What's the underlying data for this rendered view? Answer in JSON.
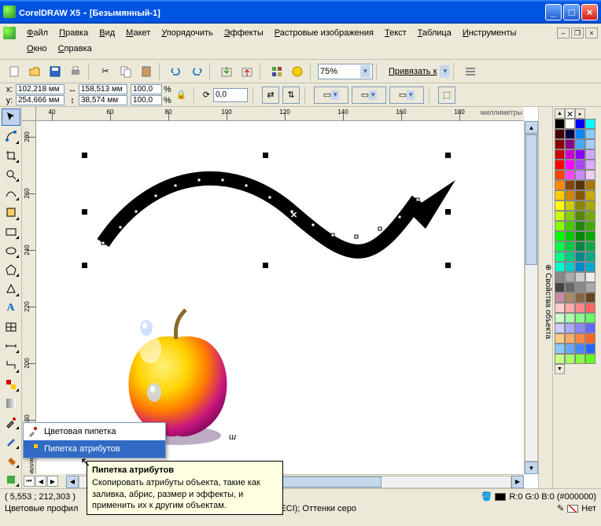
{
  "titlebar": {
    "app": "CorelDRAW X5",
    "doc": "[Безымянный-1]"
  },
  "menu": {
    "row1": [
      "Файл",
      "Правка",
      "Вид",
      "Макет",
      "Упорядочить",
      "Эффекты",
      "Растровые изображения",
      "Текст",
      "Таблица",
      "Инструменты"
    ],
    "row2": [
      "Окно",
      "Справка"
    ]
  },
  "toolbar": {
    "zoom": "75%",
    "snap": "Привязать к"
  },
  "propbar": {
    "x": "102,218 мм",
    "y": "254,666 мм",
    "w": "158,513 мм",
    "h": "38,574 мм",
    "sx": "100,0",
    "sy": "100,0",
    "rot": "0,0"
  },
  "ruler": {
    "units": "миллиметры",
    "h_ticks": [
      40,
      60,
      80,
      100,
      120,
      140,
      160,
      180
    ],
    "v_ticks": [
      280,
      260,
      240,
      220,
      200,
      180
    ],
    "v_label": "милли"
  },
  "flyout": {
    "item1": "Цветовая пипетка",
    "item2": "Пипетка атрибутов"
  },
  "tooltip": {
    "title": "Пипетка атрибутов",
    "body": "Скопировать атрибуты объекта, такие как заливка, абрис, размер и эффекты, и применить их к другим объектам."
  },
  "status": {
    "coords": "( 5,553 ; 212,303 )",
    "profiles": "Цветовые профил",
    "profile_tail": "oated v2 (ECI); Оттенки серо",
    "fill": "R:0 G:0 B:0 (#000000)",
    "outline": "Нет"
  },
  "palette": [
    [
      "#000",
      "#fff",
      "#00f",
      "#0ff"
    ],
    [
      "#400",
      "#004",
      "#08f",
      "#8cf"
    ],
    [
      "#800",
      "#808",
      "#4af",
      "#acf"
    ],
    [
      "#c00",
      "#c0c",
      "#80f",
      "#caf"
    ],
    [
      "#f00",
      "#f0f",
      "#a4f",
      "#daf"
    ],
    [
      "#f40",
      "#f4f",
      "#c8f",
      "#ecf"
    ],
    [
      "#f80",
      "#840",
      "#530",
      "#a70"
    ],
    [
      "#fc0",
      "#c80",
      "#850",
      "#ca0"
    ],
    [
      "#ff0",
      "#cc0",
      "#880",
      "#aa0"
    ],
    [
      "#cf0",
      "#8c0",
      "#580",
      "#7a0"
    ],
    [
      "#8f0",
      "#4c0",
      "#280",
      "#4a0"
    ],
    [
      "#0f0",
      "#0c0",
      "#080",
      "#0a0"
    ],
    [
      "#0f4",
      "#0c4",
      "#084",
      "#0a4"
    ],
    [
      "#0f8",
      "#0c8",
      "#088",
      "#0a8"
    ],
    [
      "#0fc",
      "#0cc",
      "#08c",
      "#0ac"
    ],
    [
      "#888",
      "#aaa",
      "#ccc",
      "#eee"
    ],
    [
      "#444",
      "#666",
      "#888",
      "#aaa"
    ],
    [
      "#c8a",
      "#a86",
      "#864",
      "#642"
    ],
    [
      "#fcc",
      "#faa",
      "#f88",
      "#f66"
    ],
    [
      "#cfc",
      "#afa",
      "#8f8",
      "#6f6"
    ],
    [
      "#ccf",
      "#aaf",
      "#88f",
      "#66f"
    ],
    [
      "#fc8",
      "#fa6",
      "#f84",
      "#f62"
    ],
    [
      "#8cf",
      "#6af",
      "#48f",
      "#26f"
    ],
    [
      "#cf8",
      "#af6",
      "#8f4",
      "#6f2"
    ]
  ]
}
